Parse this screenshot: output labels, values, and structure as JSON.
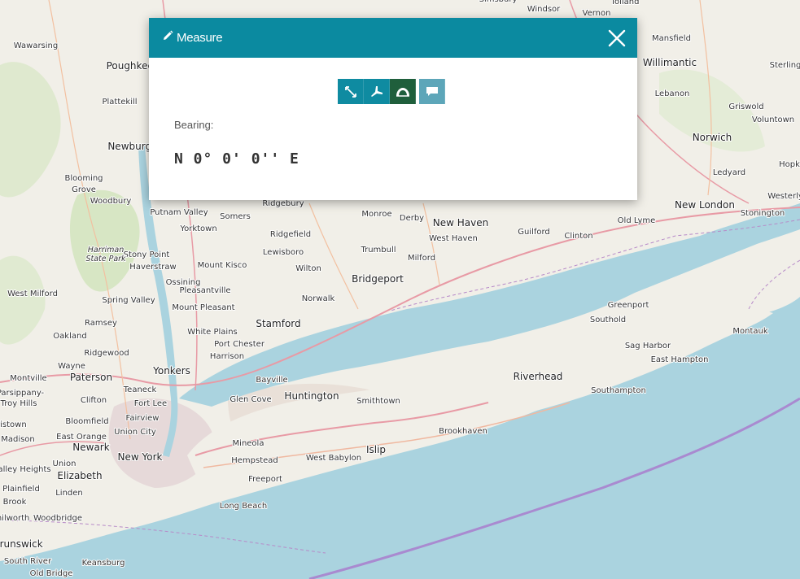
{
  "panel": {
    "title": "Measure",
    "close_icon": "close-icon",
    "tools": [
      {
        "name": "measure-distance-icon",
        "active": false
      },
      {
        "name": "measure-area-icon",
        "active": false
      },
      {
        "name": "measure-bearing-icon",
        "active": true
      },
      {
        "name": "comment-icon",
        "active": false
      }
    ],
    "result_label": "Bearing:",
    "result_value": "N 0° 0' 0'' E"
  },
  "map": {
    "labels": [
      "Tolland",
      "Windsor",
      "Vernon",
      "Simsbury",
      "Mansfield",
      "Willimantic",
      "Sterling",
      "Plainfield",
      "Lebanon",
      "Griswold",
      "Voluntown",
      "Norwich",
      "Montville",
      "Ledyard",
      "Hopk",
      "Westerly",
      "New London",
      "Stonington",
      "Old Lyme",
      "Guilford",
      "Clinton",
      "New Haven",
      "West Haven",
      "Milford",
      "Trumbull",
      "Bridgeport",
      "Derby",
      "Monroe",
      "Ridgebury",
      "Ridgefield",
      "Lewisboro",
      "Wilton",
      "Norwalk",
      "Stamford",
      "Mount Kisco",
      "Somers",
      "Putnam Valley",
      "Yorktown",
      "Ossining",
      "Pleasantville",
      "Mount Pleasant",
      "White Plains",
      "Port Chester",
      "Harrison",
      "Yonkers",
      "New York",
      "Newark",
      "Paterson",
      "Elizabeth",
      "Linden",
      "Hempstead",
      "Freeport",
      "Long Beach",
      "Mineola",
      "Huntington",
      "Smithtown",
      "Islip",
      "West Babylon",
      "Brookhaven",
      "Riverhead",
      "Southampton",
      "East Hampton",
      "Sag Harbor",
      "Montauk",
      "Greenport",
      "Southold",
      "Bayville",
      "Glen Cove",
      "Teaneck",
      "Fort Lee",
      "Fairview",
      "Union City",
      "East Orange",
      "Bloomfield",
      "Clifton",
      "Wayne",
      "Montville",
      "Ridgewood",
      "Oakland",
      "Ramsey",
      "Spring Valley",
      "West Milford",
      "Haverstraw",
      "Stony Point",
      "Harriman",
      "State Park",
      "Monroe",
      "Woodbury",
      "Blooming",
      "Grove",
      "Newburgh",
      "Plattekill",
      "Wawarsing",
      "Poughkeepsie",
      "Woodbridge",
      "Brunswick",
      "South River",
      "Old Bridge",
      "Keansburg",
      "Plainfield",
      "Brook",
      "Madison",
      "Union",
      "Valley Heights",
      "Parsippany-",
      "Troy Hills",
      "Morristown",
      "Kenilworth"
    ]
  }
}
